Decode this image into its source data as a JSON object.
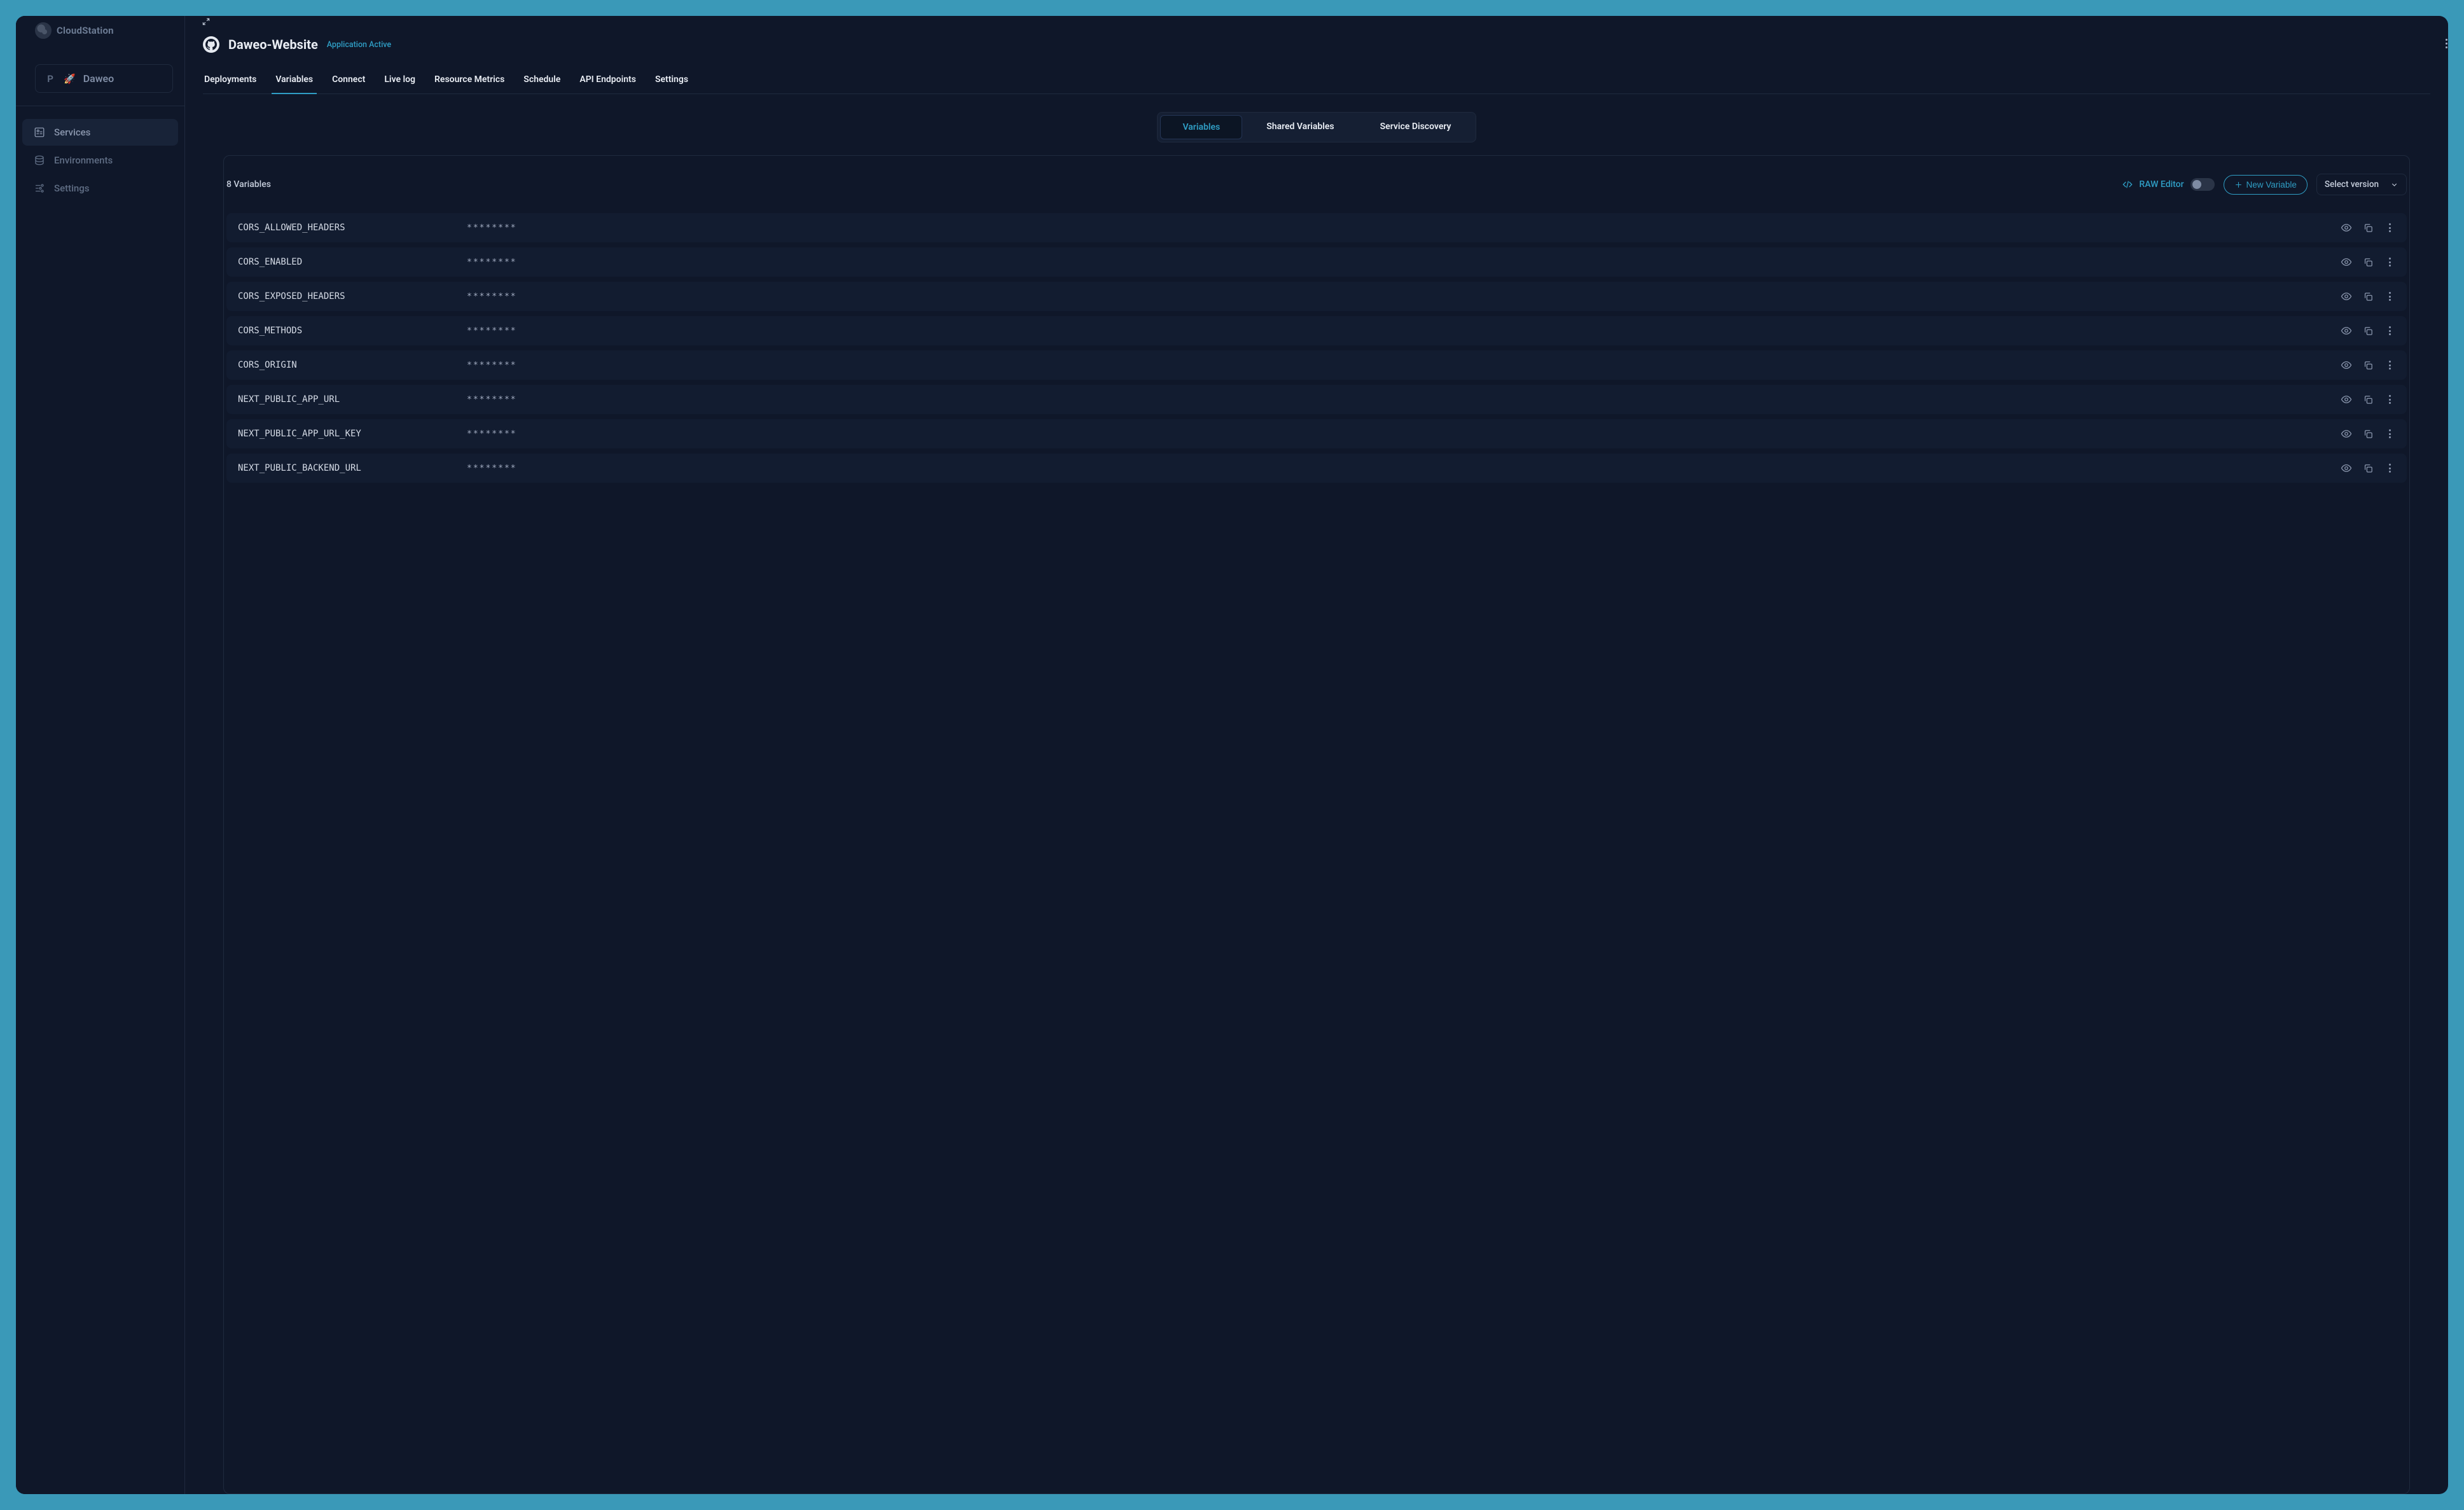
{
  "brand": "CloudStation",
  "project": {
    "letter": "P",
    "name": "Daweo"
  },
  "sidebar": {
    "items": [
      {
        "label": "Services",
        "icon": "services-icon",
        "active": true
      },
      {
        "label": "Environments",
        "icon": "environments-icon",
        "active": false
      },
      {
        "label": "Settings",
        "icon": "settings-icon",
        "active": false
      }
    ]
  },
  "header": {
    "title": "Daweo-Website",
    "status": "Application Active"
  },
  "tabs": [
    {
      "label": "Deployments",
      "active": false
    },
    {
      "label": "Variables",
      "active": true
    },
    {
      "label": "Connect",
      "active": false
    },
    {
      "label": "Live log",
      "active": false
    },
    {
      "label": "Resource Metrics",
      "active": false
    },
    {
      "label": "Schedule",
      "active": false
    },
    {
      "label": "API Endpoints",
      "active": false
    },
    {
      "label": "Settings",
      "active": false
    }
  ],
  "subtabs": [
    {
      "label": "Variables",
      "active": true
    },
    {
      "label": "Shared Variables",
      "active": false
    },
    {
      "label": "Service Discovery",
      "active": false
    }
  ],
  "toolbar": {
    "count_label": "8 Variables",
    "raw_editor_label": "RAW Editor",
    "new_variable_label": "New Variable",
    "version_label": "Select version"
  },
  "variables": [
    {
      "key": "CORS_ALLOWED_HEADERS",
      "value": "********"
    },
    {
      "key": "CORS_ENABLED",
      "value": "********"
    },
    {
      "key": "CORS_EXPOSED_HEADERS",
      "value": "********"
    },
    {
      "key": "CORS_METHODS",
      "value": "********"
    },
    {
      "key": "CORS_ORIGIN",
      "value": "********"
    },
    {
      "key": "NEXT_PUBLIC_APP_URL",
      "value": "********"
    },
    {
      "key": "NEXT_PUBLIC_APP_URL_KEY",
      "value": "********"
    },
    {
      "key": "NEXT_PUBLIC_BACKEND_URL",
      "value": "********"
    }
  ],
  "colors": {
    "accent": "#2f9dc4",
    "bg": "#0f1729",
    "row": "#121c30",
    "frame": "#3a99b8"
  }
}
